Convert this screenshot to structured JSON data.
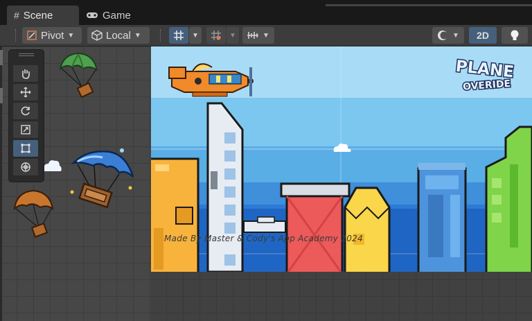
{
  "tabs": [
    {
      "label": "Scene",
      "icon": "grid-hash-icon"
    },
    {
      "label": "Game",
      "icon": "gamepad-icon"
    }
  ],
  "toolbar": {
    "pivot_label": "Pivot",
    "local_label": "Local",
    "mode_2d_label": "2D"
  },
  "tools": [
    "hand-tool",
    "move-tool",
    "rotate-tool",
    "scale-tool",
    "rect-tool",
    "transform-tool"
  ],
  "active_tool": "rect-tool",
  "game": {
    "logo_line1": "PLANE",
    "logo_line2": "OVERIDE",
    "credit_text": "Made By Master & Cody's App Academy 2024"
  },
  "colors": {
    "active_blue": "#46607c",
    "sky": "#7cc7f0",
    "sea": "#1f66c4"
  }
}
